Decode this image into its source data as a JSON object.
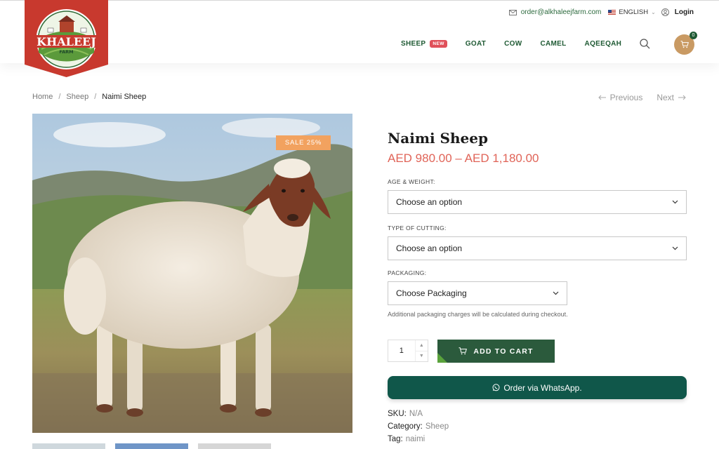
{
  "header": {
    "logo": {
      "brand": "KHALEEJ",
      "sub": "FARM"
    },
    "email": "order@alkhaleejfarm.com",
    "language": "ENGLISH",
    "login": "Login",
    "nav": [
      {
        "label": "SHEEP",
        "badge": "NEW"
      },
      {
        "label": "GOAT"
      },
      {
        "label": "COW"
      },
      {
        "label": "CAMEL"
      },
      {
        "label": "AQEEQAH"
      }
    ],
    "cart_count": "0"
  },
  "breadcrumb": {
    "home": "Home",
    "category": "Sheep",
    "current": "Naimi Sheep"
  },
  "pager": {
    "previous": "Previous",
    "next": "Next"
  },
  "product": {
    "sale_badge": "SALE 25%",
    "title": "Naimi Sheep",
    "price": "AED 980.00 – AED 1,180.00",
    "age_label": "AGE & WEIGHT:",
    "age_placeholder": "Choose an option",
    "cutting_label": "TYPE OF CUTTING:",
    "cutting_placeholder": "Choose an option",
    "packaging_label": "PACKAGING:",
    "packaging_placeholder": "Choose Packaging",
    "packaging_note": "Additional packaging charges will be calculated during checkout.",
    "quantity": "1",
    "add_to_cart": "ADD TO CART",
    "whatsapp": "Order via WhatsApp.",
    "sku_label": "SKU:",
    "sku": "N/A",
    "category_label": "Category:",
    "category": "Sheep",
    "tag_label": "Tag:",
    "tag": "naimi"
  },
  "colors": {
    "brand_green": "#1f5a34",
    "price_red": "#e06458",
    "sale_orange": "#f2a25f",
    "whatsapp_teal": "#10574a",
    "cart_tan": "#c99a63"
  }
}
